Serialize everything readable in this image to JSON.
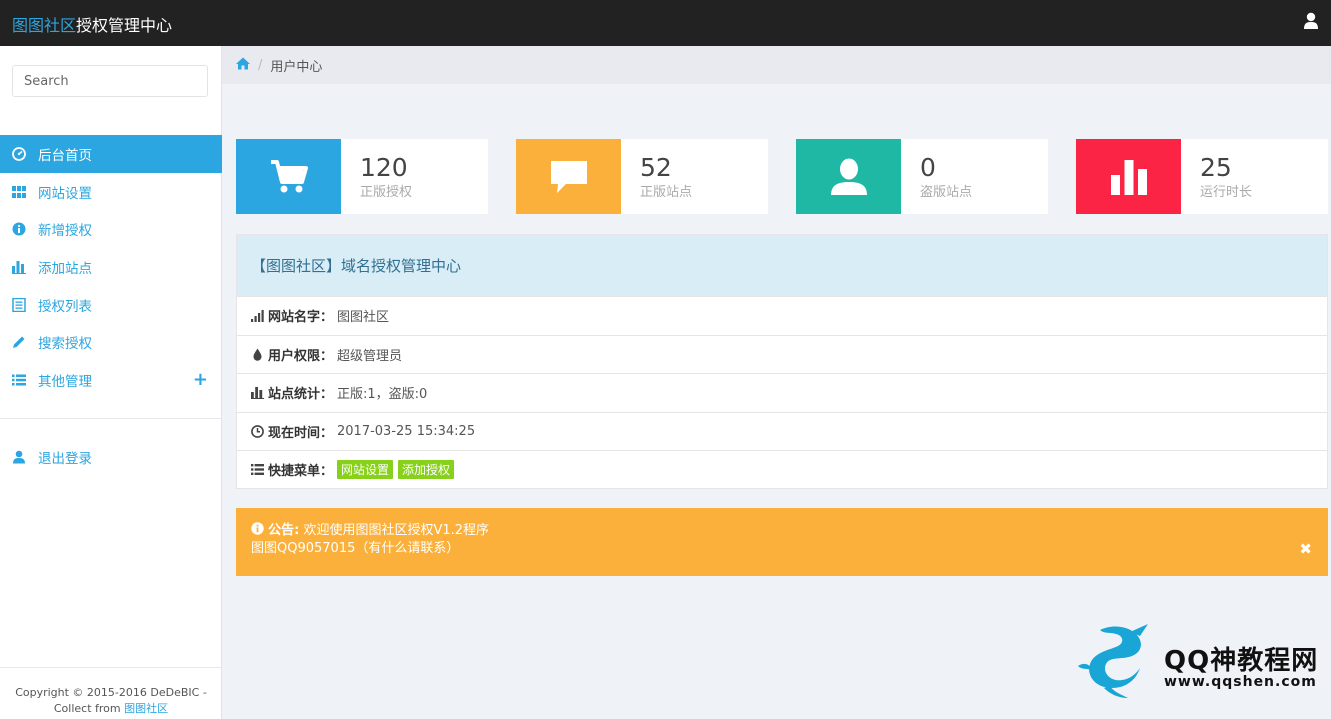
{
  "navbar": {
    "brand_highlight": "图图社区",
    "brand_rest": "授权管理中心",
    "user_icon": "user-icon"
  },
  "sidebar": {
    "search_placeholder": "Search",
    "items": [
      {
        "label": "后台首页",
        "icon": "dashboard-icon",
        "active": true
      },
      {
        "label": "网站设置",
        "icon": "grid-icon"
      },
      {
        "label": "新增授权",
        "icon": "info-icon"
      },
      {
        "label": "添加站点",
        "icon": "bar-chart-icon"
      },
      {
        "label": "授权列表",
        "icon": "list-alt-icon"
      },
      {
        "label": "搜索授权",
        "icon": "pencil-icon"
      },
      {
        "label": "其他管理",
        "icon": "list-icon"
      }
    ],
    "other_expand": "+",
    "logout_label": "退出登录",
    "footer_line1": "Copyright © 2015-2016 DeDeBIC -",
    "footer_line2_prefix": "Collect from ",
    "footer_link": "图图社区"
  },
  "breadcrumb": {
    "home_icon": "home-icon",
    "current": "用户中心"
  },
  "stats": [
    {
      "value": "120",
      "label": "正版授权",
      "color": "#2ca6e0",
      "icon": "cart-icon"
    },
    {
      "value": "52",
      "label": "正版站点",
      "color": "#fbb03b",
      "icon": "comment-icon"
    },
    {
      "value": "0",
      "label": "盗版站点",
      "color": "#1fb8a4",
      "icon": "user-icon"
    },
    {
      "value": "25",
      "label": "运行时长",
      "color": "#fb2444",
      "icon": "bar-chart-icon"
    }
  ],
  "panel": {
    "title": "【图图社区】域名授权管理中心",
    "rows": [
      {
        "key": "网站名字：",
        "value": "图图社区",
        "icon": "signal-icon"
      },
      {
        "key": "用户权限：",
        "value": "超级管理员",
        "icon": "tint-icon"
      },
      {
        "key": "站点统计：",
        "value": "正版:1，盗版:0",
        "icon": "bar-chart-icon"
      },
      {
        "key": "现在时间：",
        "value": "2017-03-25 15:34:25",
        "icon": "clock-icon"
      },
      {
        "key": "快捷菜单：",
        "icon": "list-icon"
      }
    ],
    "quick_links": [
      "网站设置",
      "添加授权"
    ]
  },
  "notice": {
    "title": "公告:",
    "line1": "欢迎使用图图社区授权V1.2程序",
    "line2": "图图QQ9057015（有什么请联系）",
    "close": "✖"
  },
  "watermark": {
    "title": "QQ神教程网",
    "url": "www.qqshen.com"
  }
}
